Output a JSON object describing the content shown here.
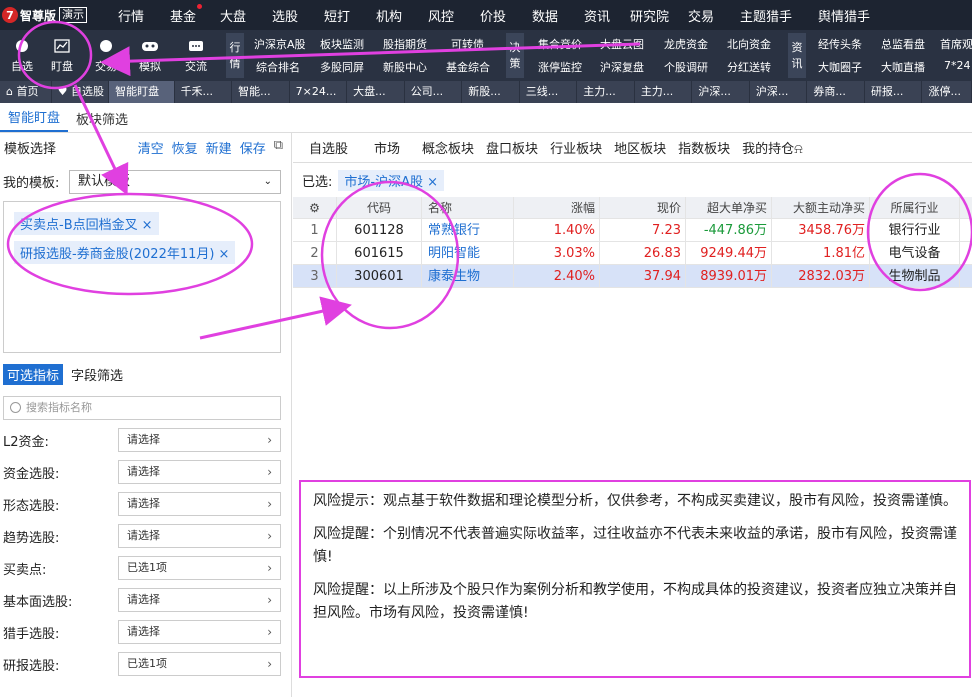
{
  "app": {
    "logo_text": "智尊版",
    "badge": "演示"
  },
  "menu": [
    "行情",
    "基金",
    "大盘",
    "选股",
    "短打",
    "机构",
    "风控",
    "价投",
    "数据",
    "资讯",
    "研究院",
    "交易",
    "主题猎手",
    "舆情猎手"
  ],
  "ribbon": {
    "big": [
      "自选",
      "盯盘",
      "交易",
      "模拟",
      "交流"
    ],
    "groups": [
      [
        "行",
        "情"
      ],
      [
        "决",
        "策"
      ],
      [
        "资",
        "讯"
      ]
    ],
    "row1_a": [
      "沪深京A股",
      "板块监测",
      "股指期货",
      "可转债"
    ],
    "row2_a": [
      "综合排名",
      "多股同屏",
      "新股中心",
      "基金综合"
    ],
    "row1_b": [
      "集合竞价",
      "大盘云图",
      "龙虎资金",
      "北向资金"
    ],
    "row2_b": [
      "涨停监控",
      "沪深复盘",
      "个股调研",
      "分红送转"
    ],
    "row1_c": [
      "经传头条",
      "总监看盘",
      "首席观"
    ],
    "row2_c": [
      "大咖圈子",
      "大咖直播",
      "7*24"
    ]
  },
  "tabs": [
    "首页",
    "自选股",
    "智能盯盘",
    "千禾...",
    "智能...",
    "7×24...",
    "大盘...",
    "公司...",
    "新股...",
    "三线...",
    "主力...",
    "主力...",
    "沪深...",
    "沪深...",
    "券商...",
    "研报...",
    "涨停..."
  ],
  "subtabs": [
    "智能盯盘",
    "板块筛选"
  ],
  "left": {
    "template_select_label": "模板选择",
    "actions": [
      "清空",
      "恢复",
      "新建",
      "保存",
      "⧉"
    ],
    "my_template_label": "我的模板:",
    "my_template_value": "默认模板",
    "tags": [
      "买卖点-B点回档金叉",
      "研报选股-券商金股(2022年11月)"
    ],
    "ind_tabs": [
      "可选指标",
      "字段筛选"
    ],
    "search_placeholder": "搜索指标名称",
    "filters": [
      {
        "label": "L2资金:",
        "value": "请选择"
      },
      {
        "label": "资金选股:",
        "value": "请选择"
      },
      {
        "label": "形态选股:",
        "value": "请选择"
      },
      {
        "label": "趋势选股:",
        "value": "请选择"
      },
      {
        "label": "买卖点:",
        "value": "已选1项"
      },
      {
        "label": "基本面选股:",
        "value": "请选择"
      },
      {
        "label": "猎手选股:",
        "value": "请选择"
      },
      {
        "label": "研报选股:",
        "value": "已选1项"
      }
    ]
  },
  "right": {
    "categories": [
      "自选股",
      "市场",
      "概念板块",
      "盘口板块",
      "行业板块",
      "地区板块",
      "指数板块",
      "我的持仓"
    ],
    "selected_label": "已选:",
    "selected_chip": "市场-沪深A股",
    "columns": [
      "代码",
      "名称",
      "涨幅",
      "现价",
      "超大单净买",
      "大额主动净买",
      "所属行业"
    ],
    "rows": [
      {
        "idx": "1",
        "code": "601128",
        "name": "常熟银行",
        "chg": "1.40%",
        "price": "7.23",
        "xl": "-447.86万",
        "big": "3458.76万",
        "ind": "银行行业"
      },
      {
        "idx": "2",
        "code": "601615",
        "name": "明阳智能",
        "chg": "3.03%",
        "price": "26.83",
        "xl": "9249.44万",
        "big": "1.81亿",
        "ind": "电气设备"
      },
      {
        "idx": "3",
        "code": "300601",
        "name": "康泰生物",
        "chg": "2.40%",
        "price": "37.94",
        "xl": "8939.01万",
        "big": "2832.03万",
        "ind": "生物制品"
      }
    ]
  },
  "risk": [
    "风险提示：观点基于软件数据和理论模型分析，仅供参考，不构成买卖建议，股市有风险，投资需谨慎。",
    "风险提醒：个别情况不代表普遍实际收益率，过往收益亦不代表未来收益的承诺，股市有风险，投资需谨慎!",
    "风险提醒：以上所涉及个股只作为案例分析和教学使用，不构成具体的投资建议，投资者应独立决策并自担风险。市场有风险，投资需谨慎!"
  ],
  "colors": {
    "accent": "#1f6fd1",
    "up": "#e02020",
    "down": "#1a9a3a",
    "annotation": "#e040e0"
  }
}
